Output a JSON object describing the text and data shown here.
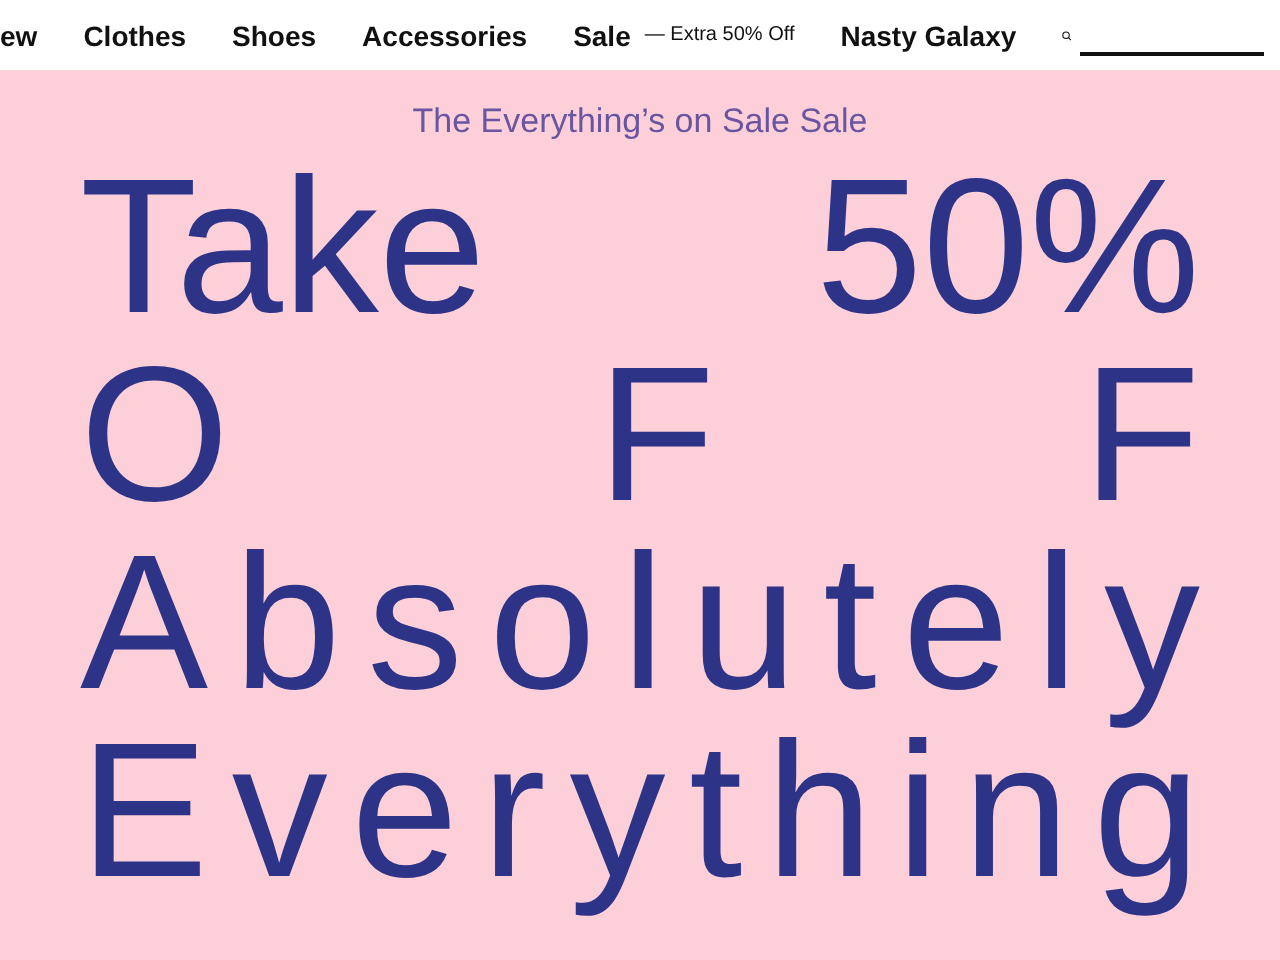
{
  "nav": {
    "items": [
      {
        "label": "ew"
      },
      {
        "label": "Clothes"
      },
      {
        "label": "Shoes"
      },
      {
        "label": "Accessories"
      },
      {
        "label": "Sale"
      },
      {
        "label": "Nasty Galaxy"
      }
    ],
    "sale_note": "— Extra 50% Off"
  },
  "hero": {
    "eyebrow": "The Everything’s on Sale Sale",
    "lines": [
      {
        "kind": "split",
        "words": [
          "Take",
          "50%"
        ]
      },
      {
        "kind": "split",
        "words": [
          "O",
          "F",
          "F"
        ]
      },
      {
        "kind": "spread",
        "text": "Absolutely"
      },
      {
        "kind": "spread",
        "text": "Everything"
      }
    ]
  }
}
